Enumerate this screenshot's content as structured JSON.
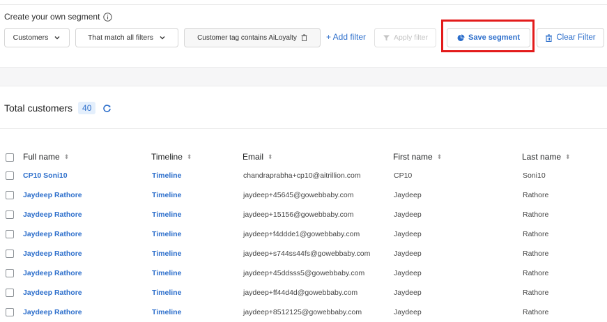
{
  "segment": {
    "title": "Create your own segment",
    "customers_select": "Customers",
    "match_select": "That match all filters",
    "filter_chip": "Customer tag contains AiLoyalty",
    "add_filter": "+ Add filter",
    "apply_filter": "Apply filter",
    "save_segment": "Save segment",
    "clear_filter": "Clear Filter"
  },
  "summary": {
    "label": "Total customers",
    "count": "40"
  },
  "table": {
    "headers": [
      "Full name",
      "Timeline",
      "Email",
      "First name",
      "Last name"
    ],
    "rows": [
      {
        "full_name": "CP10 Soni10",
        "timeline": "Timeline",
        "email": "chandraprabha+cp10@aitrillion.com",
        "first_name": "CP10",
        "last_name": "Soni10"
      },
      {
        "full_name": "Jaydeep Rathore",
        "timeline": "Timeline",
        "email": "jaydeep+45645@gowebbaby.com",
        "first_name": "Jaydeep",
        "last_name": "Rathore"
      },
      {
        "full_name": "Jaydeep Rathore",
        "timeline": "Timeline",
        "email": "jaydeep+15156@gowebbaby.com",
        "first_name": "Jaydeep",
        "last_name": "Rathore"
      },
      {
        "full_name": "Jaydeep Rathore",
        "timeline": "Timeline",
        "email": "jaydeep+f4ddde1@gowebbaby.com",
        "first_name": "Jaydeep",
        "last_name": "Rathore"
      },
      {
        "full_name": "Jaydeep Rathore",
        "timeline": "Timeline",
        "email": "jaydeep+s744ss44fs@gowebbaby.com",
        "first_name": "Jaydeep",
        "last_name": "Rathore"
      },
      {
        "full_name": "Jaydeep Rathore",
        "timeline": "Timeline",
        "email": "jaydeep+45ddsss5@gowebbaby.com",
        "first_name": "Jaydeep",
        "last_name": "Rathore"
      },
      {
        "full_name": "Jaydeep Rathore",
        "timeline": "Timeline",
        "email": "jaydeep+ff44d4d@gowebbaby.com",
        "first_name": "Jaydeep",
        "last_name": "Rathore"
      },
      {
        "full_name": "Jaydeep Rathore",
        "timeline": "Timeline",
        "email": "jaydeep+8512125@gowebbaby.com",
        "first_name": "Jaydeep",
        "last_name": "Rathore"
      }
    ]
  },
  "icons": {
    "info": "info-icon",
    "chevron": "chevron-down-icon",
    "trash": "trash-icon",
    "filter": "filter-icon",
    "pie": "pie-chart-icon",
    "refresh": "refresh-icon",
    "sort": "sort-icon"
  },
  "colors": {
    "link": "#2c6ecb",
    "highlight": "#e31b1b",
    "disabled": "#c4c4c4",
    "count_bg": "#e4effc"
  }
}
